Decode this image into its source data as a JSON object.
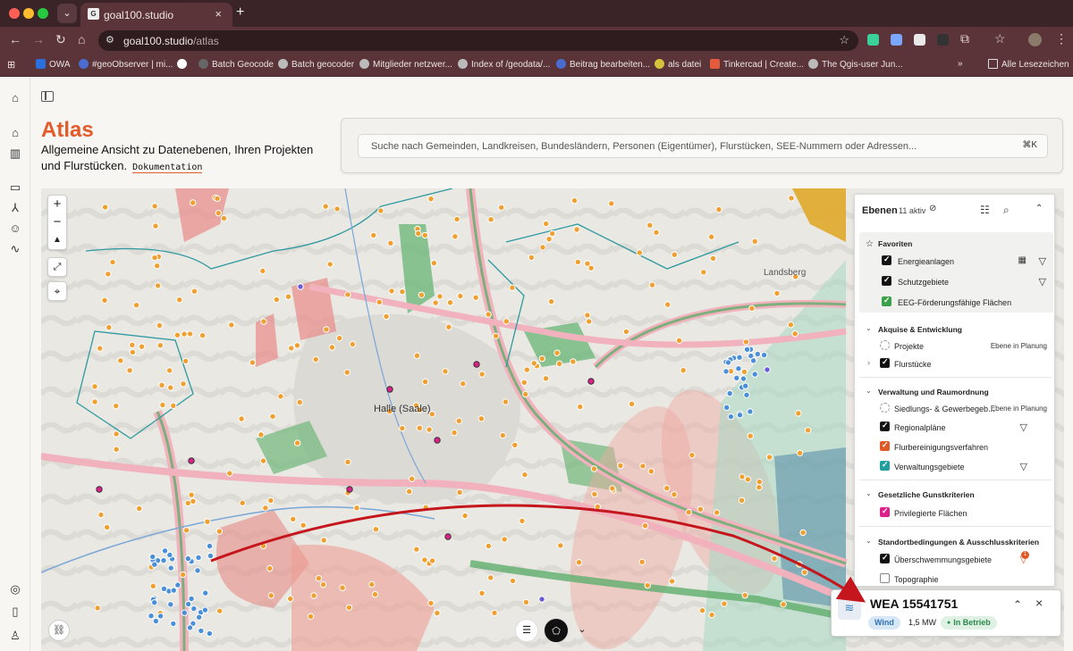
{
  "browser": {
    "tab_title": "goal100.studio",
    "url_host": "goal100.studio",
    "url_path": "/atlas",
    "bookmarks": [
      "OWA",
      "#geoObserver | mi...",
      "Batch Geocode",
      "Batch geocoder",
      "Mitglieder netzwer...",
      "Index of /geodata/...",
      "Beitrag bearbeiten...",
      "als datei",
      "Tinkercad | Create...",
      "The Qgis-user Jun..."
    ],
    "all_bookmarks": "Alle Lesezeichen",
    "ext_badge": "15"
  },
  "page": {
    "title": "Atlas",
    "description": "Allgemeine Ansicht zu Datenebenen, Ihren Projekten und Flurstücken.",
    "doc_link": "Dokumentation"
  },
  "search": {
    "placeholder": "Suche nach Gemeinden, Landkreisen, Bundesländern, Personen (Eigentümer), Flurstücken, SEE-Nummern oder Adressen...",
    "shortcut": "⌘K"
  },
  "map": {
    "labels": {
      "city": "Halle (Saale)",
      "town": "Landsberg"
    }
  },
  "layers": {
    "title": "Ebenen",
    "count": "11 aktiv",
    "favorites_title": "Favoriten",
    "favorites": [
      {
        "label": "Energieanlagen",
        "color": "#111111"
      },
      {
        "label": "Schutzgebiete",
        "color": "#111111"
      },
      {
        "label": "EEG-Förderungsfähige Flächen",
        "color": "#3aa04a"
      }
    ],
    "sections": [
      {
        "title": "Akquise & Entwicklung",
        "items": [
          {
            "label": "Projekte",
            "tag": "Ebene in Planung"
          },
          {
            "label": "Flurstücke"
          }
        ]
      },
      {
        "title": "Verwaltung und Raumordnung",
        "items": [
          {
            "label": "Siedlungs- & Gewerbegeb...",
            "tag": "Ebene in Planung"
          },
          {
            "label": "Regionalpläne",
            "color": "#111111"
          },
          {
            "label": "Flurbereinigungsverfahren",
            "color": "#e05a2a"
          },
          {
            "label": "Verwaltungsgebiete",
            "color": "#20a0a0"
          }
        ]
      },
      {
        "title": "Gesetzliche Gunstkriterien",
        "items": [
          {
            "label": "Privilegierte Flächen",
            "color": "#e0208a"
          }
        ]
      },
      {
        "title": "Standortbedingungen & Ausschlusskriterien",
        "items": [
          {
            "label": "Überschwemmungsgebiete",
            "color": "#111111",
            "filter_badge": "1"
          },
          {
            "label": "Topographie"
          }
        ]
      }
    ]
  },
  "info_card": {
    "title": "WEA 15541751",
    "type": "Wind",
    "power": "1,5 MW",
    "status": "In Betrieb"
  }
}
